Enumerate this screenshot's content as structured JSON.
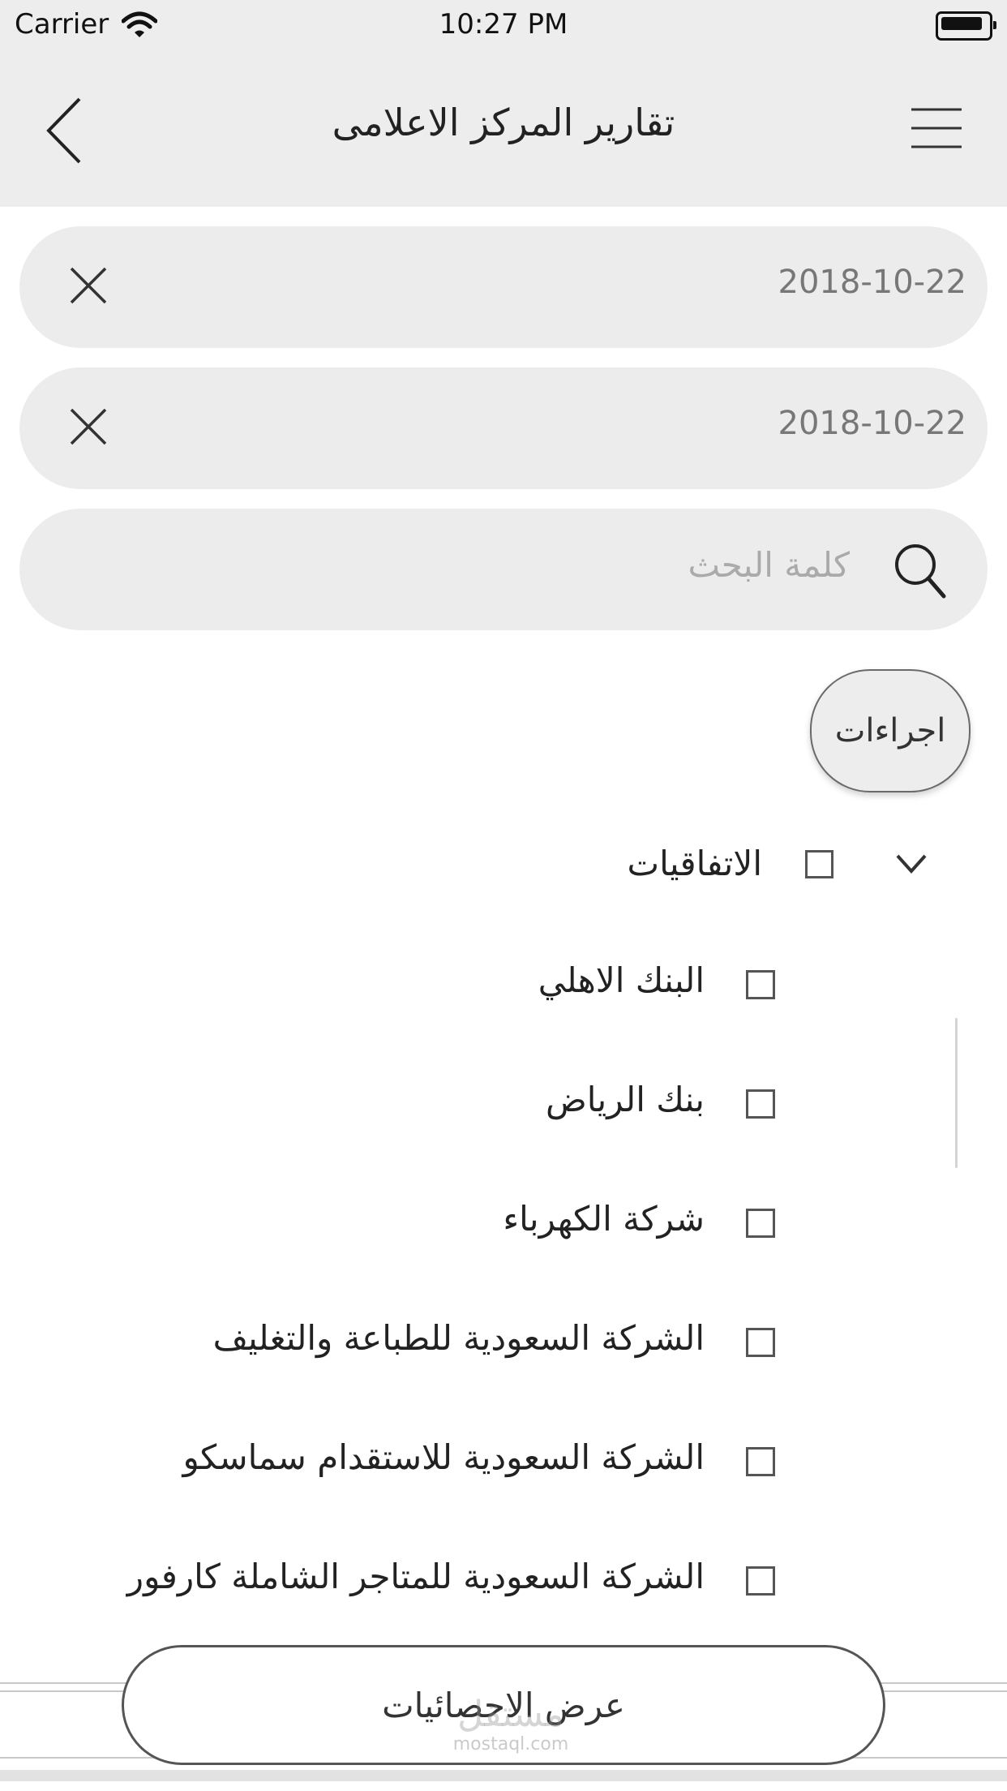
{
  "status_bar": {
    "carrier": "Carrier",
    "time": "10:27 PM"
  },
  "nav": {
    "title": "تقارير المركز الاعلامى"
  },
  "filters": {
    "date_from": "2018-10-22",
    "date_to": "2018-10-22",
    "search_placeholder": "كلمة البحث"
  },
  "actions_label": "اجراءات",
  "group": {
    "label": "الاتفاقيات",
    "checked": false
  },
  "items": [
    {
      "label": "البنك الاهلي",
      "checked": false
    },
    {
      "label": "بنك الرياض",
      "checked": false
    },
    {
      "label": "شركة الكهرباء",
      "checked": false
    },
    {
      "label": "الشركة السعودية للطباعة والتغليف",
      "checked": false
    },
    {
      "label": "الشركة السعودية للاستقدام  سماسكو",
      "checked": false
    },
    {
      "label": "الشركة السعودية للمتاجر الشاملة كارفور",
      "checked": false
    }
  ],
  "stats_button_label": "عرض الاحصائيات",
  "watermark": {
    "main": "مستقل",
    "sub": "mostaql.com"
  },
  "colors": {
    "bar_background": "#ededed",
    "field_background": "#ececec"
  },
  "icons": [
    "wifi-icon",
    "battery-icon",
    "back-chevron-icon",
    "hamburger-menu-icon",
    "clear-icon",
    "search-icon",
    "chevron-down-icon"
  ]
}
